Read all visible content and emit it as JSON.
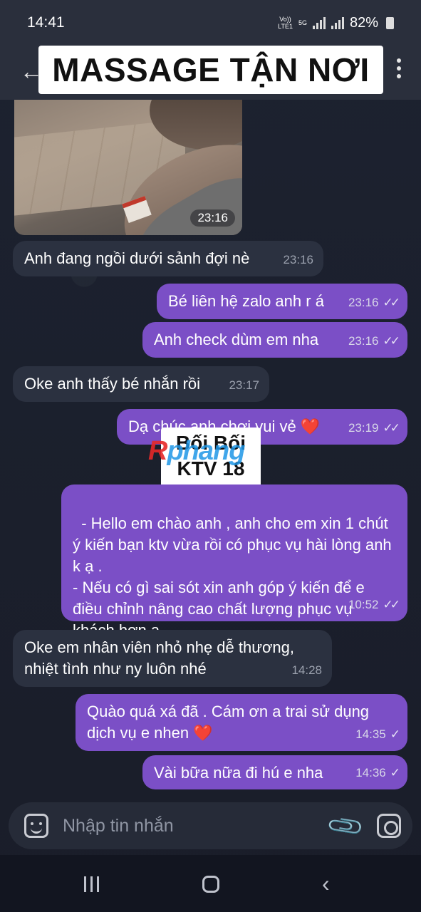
{
  "status_bar": {
    "time": "14:41",
    "network_vo": "Vo))\nLTE1",
    "network_5g": "5G",
    "battery": "82%"
  },
  "header": {
    "title": "MASSAGE TẬN NƠI"
  },
  "photo": {
    "time": "23:16"
  },
  "messages": [
    {
      "direction": "in",
      "text": "Anh đang ngồi dưới sảnh đợi nè",
      "time": "23:16"
    },
    {
      "direction": "out",
      "text": "Bé liên hệ zalo anh r á",
      "time": "23:16",
      "status": "read"
    },
    {
      "direction": "out",
      "text": "Anh check dùm em nha",
      "time": "23:16",
      "status": "read"
    },
    {
      "direction": "in",
      "text": "Oke anh thấy bé nhắn rồi",
      "time": "23:17"
    },
    {
      "direction": "out",
      "text": "Dạ chúc anh chơi vui vẻ ❤️",
      "time": "23:19",
      "status": "read"
    },
    {
      "direction": "out",
      "text": "- Hello em chào anh , anh cho em xin 1 chút ý kiến bạn ktv vừa rồi có phục vụ hài lòng anh k ạ .\n- Nếu có gì sai sót xin anh góp ý kiến để e điều chỉnh nâng cao chất lượng phục vụ khách hơn ạ .",
      "time": "10:52",
      "status": "read"
    },
    {
      "direction": "in",
      "text": "Oke em nhân viên nhỏ nhẹ dễ thương, nhiệt tình như ny luôn nhé",
      "time": "14:28"
    },
    {
      "direction": "out",
      "text": "Quào quá xá đã . Cám ơn a trai sử dụng dịch vụ e nhen ❤️",
      "time": "14:35",
      "status": "sent"
    },
    {
      "direction": "out",
      "text": "Vài bữa nữa đi hú e nha",
      "time": "14:36",
      "status": "sent"
    }
  ],
  "sticker": {
    "line1": "Bối Bối",
    "line2": "KTV 18"
  },
  "watermark": {
    "part1": "R",
    "part2": "phang"
  },
  "input": {
    "placeholder": "Nhập tin nhắn"
  },
  "colors": {
    "outgoing_bubble": "#7b4fc6",
    "incoming_bubble": "#2b3140",
    "header_bg": "#2a2f3c"
  }
}
